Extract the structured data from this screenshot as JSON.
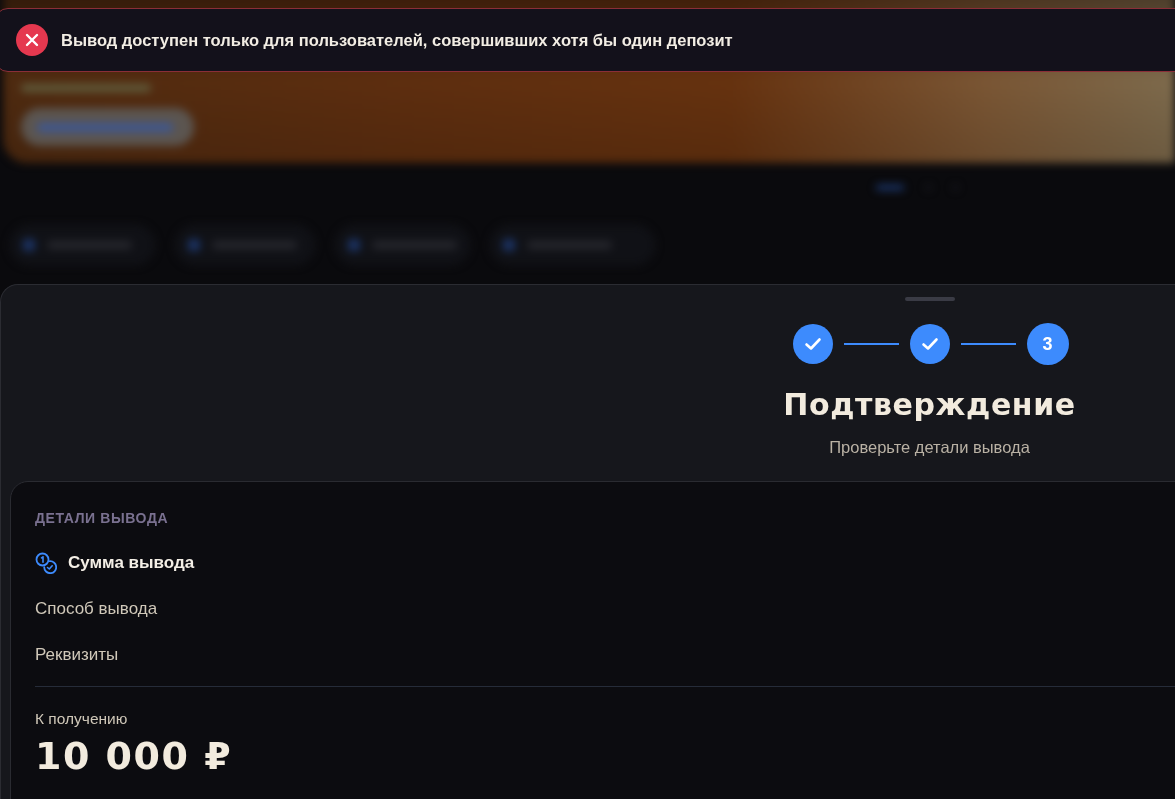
{
  "toast": {
    "kind": "error",
    "message": "Вывод доступен только для пользователей, совершивших хотя бы один депозит"
  },
  "stepper": {
    "steps": [
      {
        "completed": true
      },
      {
        "completed": true
      },
      {
        "completed": false,
        "number": "3"
      }
    ]
  },
  "heading": {
    "title": "Подтверждение",
    "subtitle": "Проверьте детали вывода"
  },
  "details": {
    "section_title": "ДЕТАЛИ ВЫВОДА",
    "rows": [
      {
        "label": "Сумма вывода",
        "active": true
      },
      {
        "label": "Способ вывода",
        "active": false
      },
      {
        "label": "Реквизиты",
        "active": false
      }
    ],
    "total": {
      "label": "К получению",
      "amount": "10 000 ₽"
    }
  }
}
